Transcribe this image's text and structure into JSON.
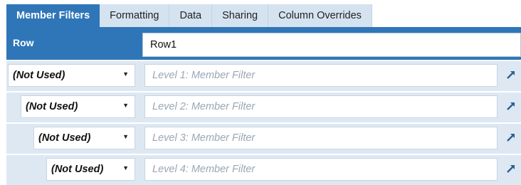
{
  "tabs": [
    "Member Filters",
    "Formatting",
    "Data",
    "Sharing",
    "Column Overrides"
  ],
  "row": {
    "label": "Row",
    "value": "Row1"
  },
  "levels": [
    {
      "dropdown": "(Not Used)",
      "placeholder": "Level 1: Member Filter"
    },
    {
      "dropdown": "(Not Used)",
      "placeholder": "Level 2: Member Filter"
    },
    {
      "dropdown": "(Not Used)",
      "placeholder": "Level 3: Member Filter"
    },
    {
      "dropdown": "(Not Used)",
      "placeholder": "Level 4: Member Filter"
    }
  ],
  "icons": {
    "dropdown_arrow": "caret-down-icon",
    "expand": "expand-arrow-icon"
  },
  "colors": {
    "accent": "#2f76b8",
    "tab_inactive": "#d5e3f0",
    "row_bg": "#dde8f3",
    "placeholder": "#9aa7b4"
  }
}
